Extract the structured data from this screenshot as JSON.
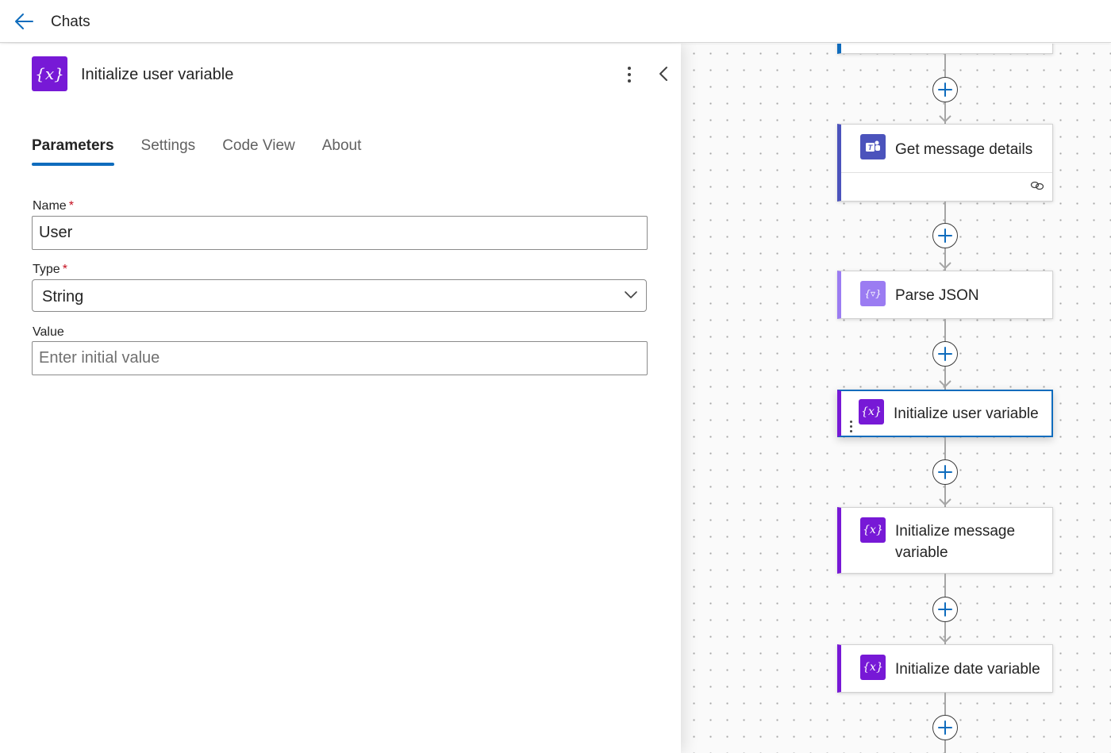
{
  "topbar": {
    "title": "Chats"
  },
  "panel": {
    "title": "Initialize user variable",
    "icon": "variable-icon",
    "tabs": [
      {
        "label": "Parameters",
        "active": true
      },
      {
        "label": "Settings",
        "active": false
      },
      {
        "label": "Code View",
        "active": false
      },
      {
        "label": "About",
        "active": false
      }
    ],
    "fields": {
      "name": {
        "label": "Name",
        "required_mark": "*",
        "value": "User"
      },
      "type": {
        "label": "Type",
        "required_mark": "*",
        "value": "String"
      },
      "value": {
        "label": "Value",
        "placeholder": "Enter initial value",
        "value": ""
      }
    }
  },
  "flow": {
    "nodes": [
      {
        "label": "Get message details",
        "icon": "teams-icon",
        "color": "#4b53bc"
      },
      {
        "label": "Parse JSON",
        "icon": "parse-json-icon",
        "color": "#9b7cf2"
      },
      {
        "label": "Initialize user variable",
        "icon": "variable-icon",
        "color": "#7719d6",
        "selected": true
      },
      {
        "label_line1": "Initialize message",
        "label_line2": "variable",
        "icon": "variable-icon",
        "color": "#7719d6"
      },
      {
        "label": "Initialize date variable",
        "icon": "variable-icon",
        "color": "#7719d6"
      }
    ]
  },
  "colors": {
    "accent": "#0f6cbd",
    "variable": "#7719d6",
    "teams": "#4b53bc",
    "parse_json": "#9b7cf2"
  }
}
